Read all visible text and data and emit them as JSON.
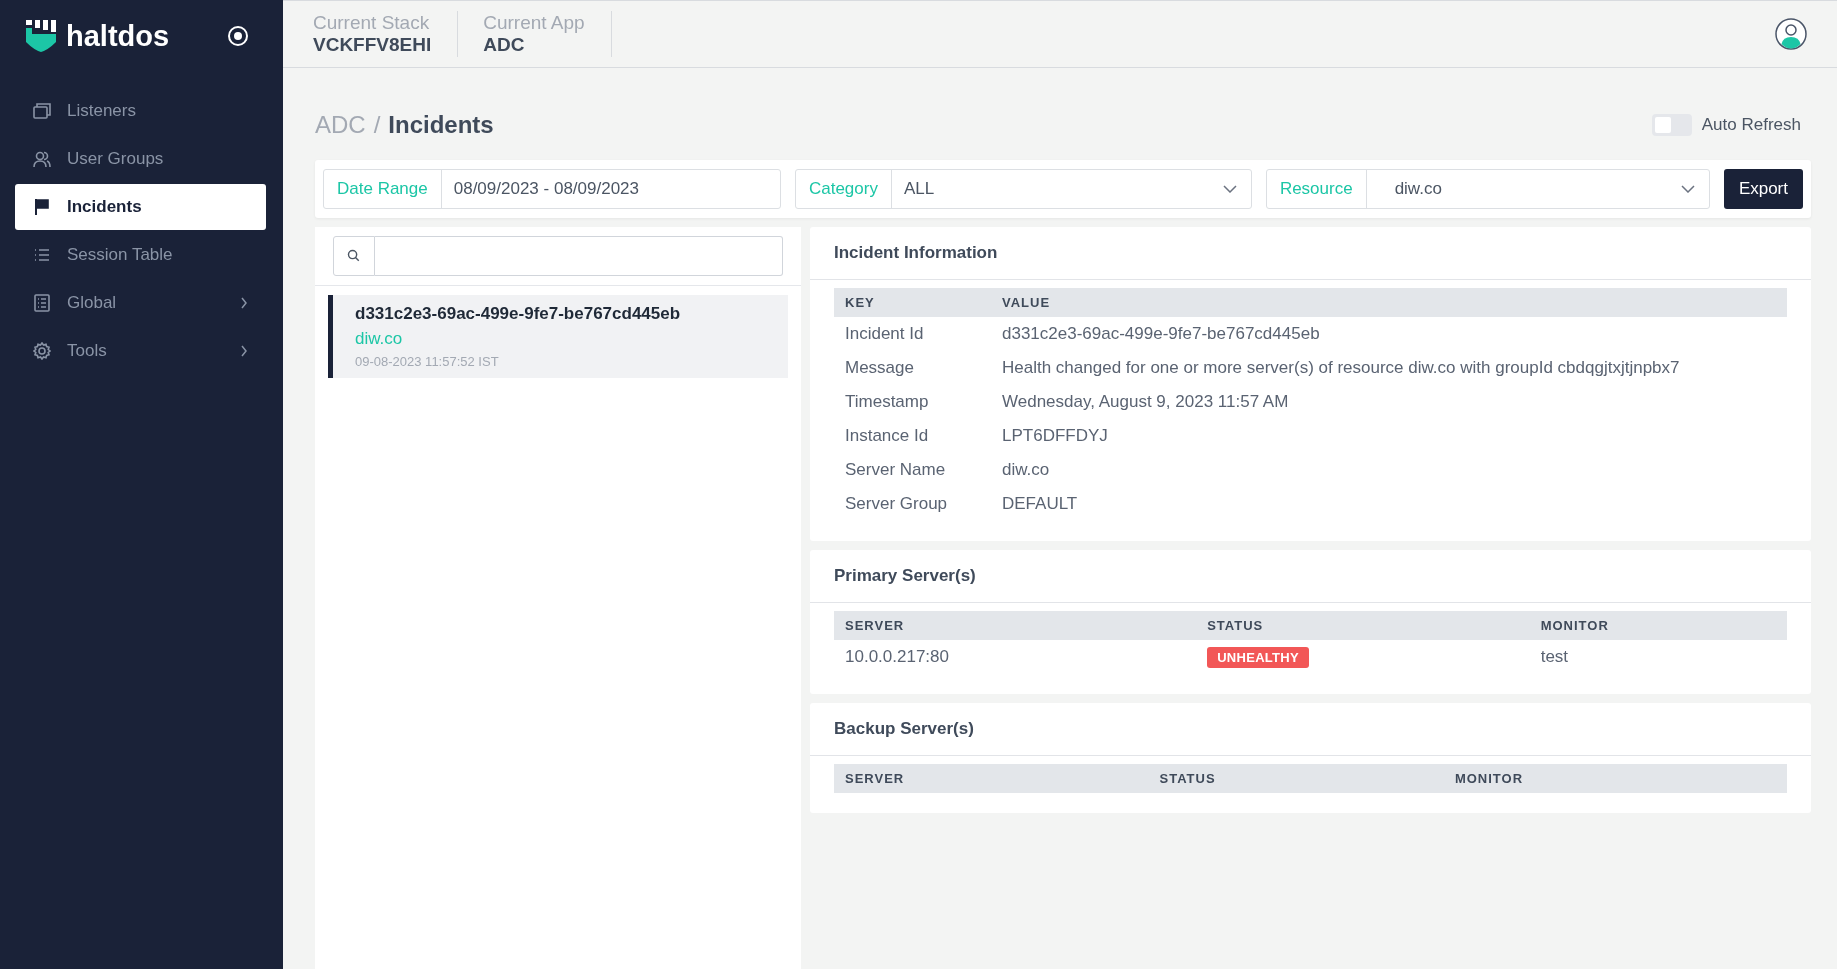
{
  "brand": {
    "name": "haltdos"
  },
  "sidebar": {
    "items": [
      {
        "label": "Listeners",
        "selected": false,
        "expandable": false
      },
      {
        "label": "User Groups",
        "selected": false,
        "expandable": false
      },
      {
        "label": "Incidents",
        "selected": true,
        "expandable": false
      },
      {
        "label": "Session Table",
        "selected": false,
        "expandable": false
      },
      {
        "label": "Global",
        "selected": false,
        "expandable": true
      },
      {
        "label": "Tools",
        "selected": false,
        "expandable": true
      }
    ]
  },
  "header": {
    "contexts": [
      {
        "label": "Current Stack",
        "value": "VCKFFV8EHI"
      },
      {
        "label": "Current App",
        "value": "ADC"
      }
    ]
  },
  "breadcrumb": {
    "parent": "ADC",
    "separator": "/",
    "current": "Incidents"
  },
  "auto_refresh": {
    "label": "Auto Refresh",
    "on": false
  },
  "filters": [
    {
      "label": "Date Range",
      "value": "08/09/2023 - 08/09/2023",
      "kind": "text"
    },
    {
      "label": "Category",
      "value": "ALL",
      "kind": "select"
    },
    {
      "label": "Resource",
      "value": "diw.co",
      "kind": "select"
    }
  ],
  "export_button": "Export",
  "incident_list": [
    {
      "id": "d331c2e3-69ac-499e-9fe7-be767cd445eb",
      "resource": "diw.co",
      "time": "09-08-2023 11:57:52 IST",
      "selected": true
    }
  ],
  "incident_info": {
    "title": "Incident Information",
    "columns": [
      "KEY",
      "VALUE"
    ],
    "rows": [
      {
        "key": "Incident Id",
        "value": "d331c2e3-69ac-499e-9fe7-be767cd445eb"
      },
      {
        "key": "Message",
        "value": "Health changed for one or more server(s) of resource diw.co with groupId cbdqgjtxjtjnpbx7"
      },
      {
        "key": "Timestamp",
        "value": "Wednesday, August 9, 2023 11:57 AM"
      },
      {
        "key": "Instance Id",
        "value": "LPT6DFFDYJ"
      },
      {
        "key": "Server Name",
        "value": "diw.co"
      },
      {
        "key": "Server Group",
        "value": "DEFAULT"
      }
    ]
  },
  "server_tables": [
    {
      "title": "Primary Server(s)",
      "columns": [
        "SERVER",
        "STATUS",
        "MONITOR"
      ],
      "rows": [
        {
          "server": "10.0.0.217:80",
          "status": {
            "label": "UNHEALTHY",
            "kind": "unhealthy"
          },
          "monitor": "test"
        }
      ]
    },
    {
      "title": "Backup Server(s)",
      "columns": [
        "SERVER",
        "STATUS",
        "MONITOR"
      ]
    }
  ]
}
